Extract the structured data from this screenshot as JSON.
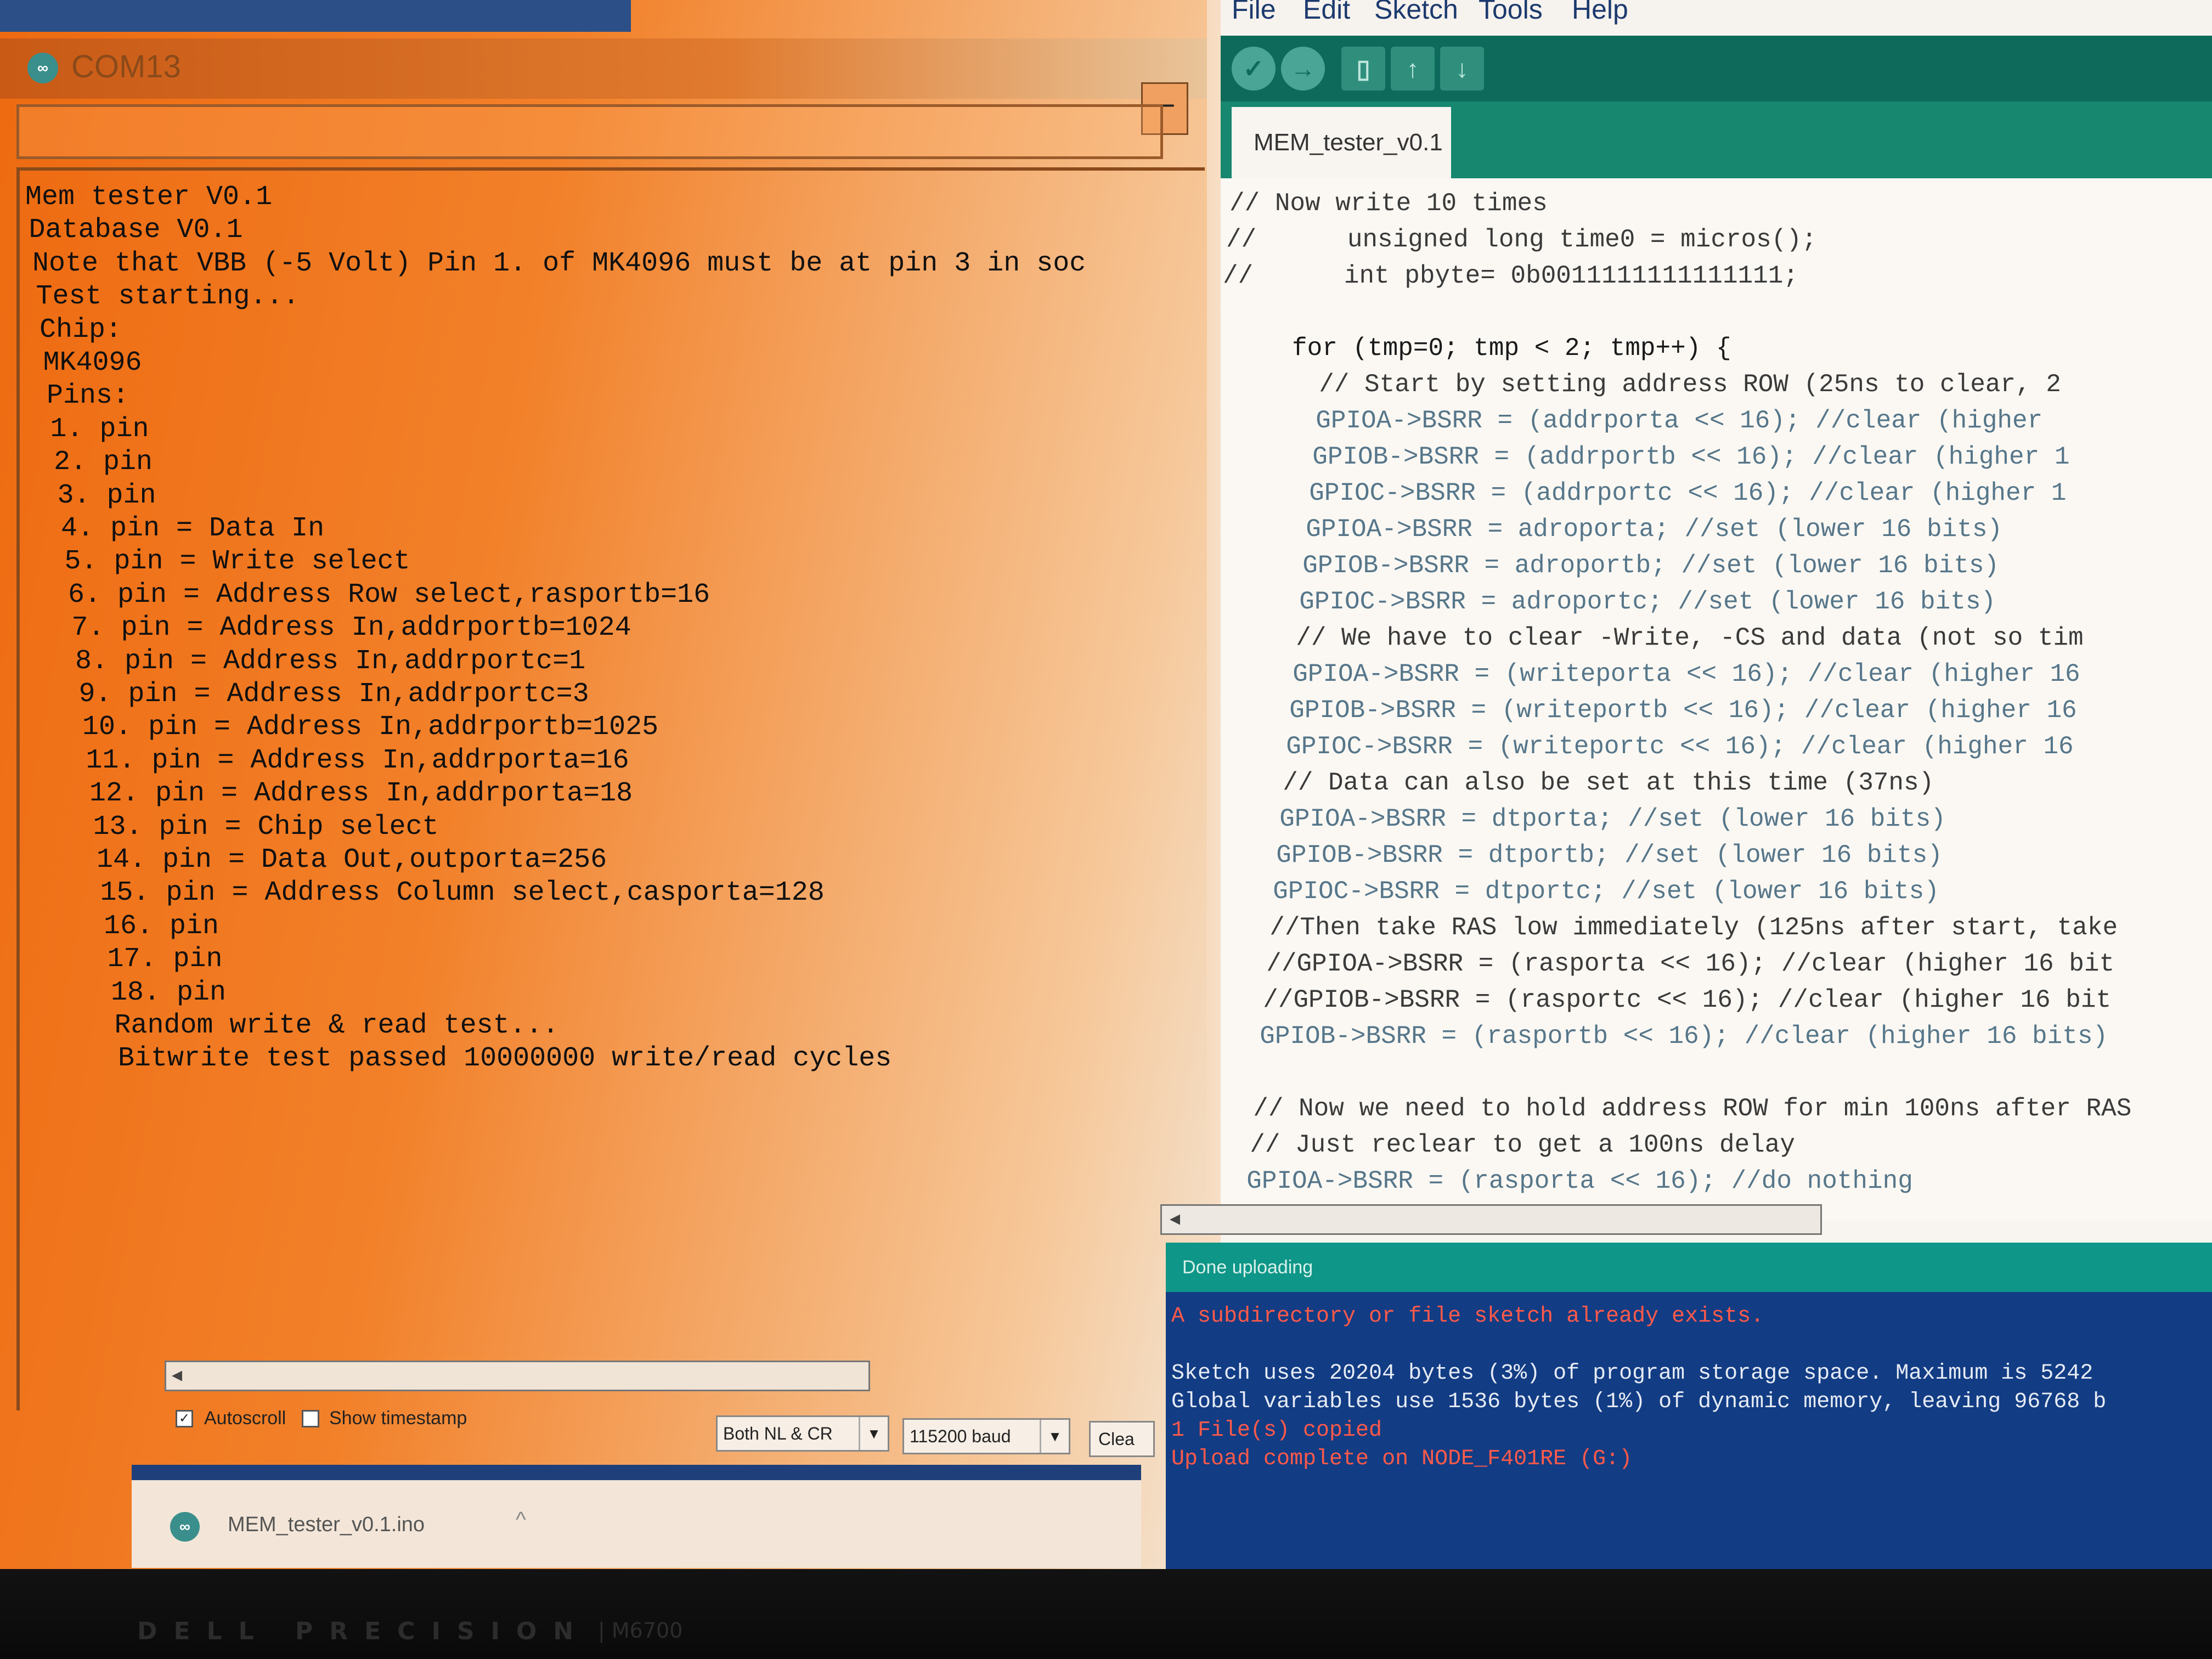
{
  "serial_monitor": {
    "title": "COM13",
    "output_lines": [
      "Mem tester V0.1",
      "Database V0.1",
      "Note that VBB (-5 Volt) Pin 1. of MK4096 must be at pin 3 in soc",
      "Test starting...",
      "Chip:",
      "MK4096",
      "Pins:",
      "1. pin",
      "2. pin",
      "3. pin",
      "4. pin = Data In",
      "5. pin = Write select",
      "6. pin = Address Row select,rasportb=16",
      "7. pin = Address In,addrportb=1024",
      "8. pin = Address In,addrportc=1",
      "9. pin = Address In,addrportc=3",
      "10. pin = Address In,addrportb=1025",
      "11. pin = Address In,addrporta=16",
      "12. pin = Address In,addrporta=18",
      "13. pin = Chip select",
      "14. pin = Data Out,outporta=256",
      "15. pin = Address Column select,casporta=128",
      "16. pin",
      "17. pin",
      "18. pin",
      "Random write & read test...",
      "Bitwrite test passed 10000000 write/read cycles"
    ],
    "autoscroll_label": "Autoscroll",
    "autoscroll_checked": true,
    "timestamp_label": "Show timestamp",
    "timestamp_checked": false,
    "line_ending": "Both NL & CR",
    "baud": "115200 baud",
    "clear_label": "Clea",
    "minimize_label": "–"
  },
  "taskbar": {
    "file": "MEM_tester_v0.1.ino",
    "caret": "^"
  },
  "ide": {
    "menu": [
      "File",
      "Edit",
      "Sketch",
      "Tools",
      "Help"
    ],
    "toolbar_icons": [
      "verify-icon",
      "upload-icon",
      "new-icon",
      "open-icon",
      "save-icon"
    ],
    "tab": "MEM_tester_v0.1",
    "code_lines": [
      "// Now write 10 times",
      "//      unsigned long time0 = micros();",
      "//      int pbyte= 0b0011111111111111;",
      "",
      "     for (tmp=0; tmp < 2; tmp++) {",
      "       // Start by setting address ROW (25ns to clear, 2",
      "       GPIOA->BSRR = (addrporta << 16); //clear (higher",
      "       GPIOB->BSRR = (addrportb << 16); //clear (higher 1",
      "       GPIOC->BSRR = (addrportc << 16); //clear (higher 1",
      "       GPIOA->BSRR = adroporta; //set (lower 16 bits)",
      "       GPIOB->BSRR = adroportb; //set (lower 16 bits)",
      "       GPIOC->BSRR = adroportc; //set (lower 16 bits)",
      "       // We have to clear -Write, -CS and data (not so tim",
      "       GPIOA->BSRR = (writeporta << 16); //clear (higher 16",
      "       GPIOB->BSRR = (writeportb << 16); //clear (higher 16",
      "       GPIOC->BSRR = (writeportc << 16); //clear (higher 16",
      "       // Data can also be set at this time (37ns)",
      "       GPIOA->BSRR = dtporta; //set (lower 16 bits)",
      "       GPIOB->BSRR = dtportb; //set (lower 16 bits)",
      "       GPIOC->BSRR = dtportc; //set (lower 16 bits)",
      "       //Then take RAS low immediately (125ns after start, take",
      "       //GPIOA->BSRR = (rasporta << 16); //clear (higher 16 bit",
      "       //GPIOB->BSRR = (rasportc << 16); //clear (higher 16 bit",
      "       GPIOB->BSRR = (rasportb << 16); //clear (higher 16 bits)",
      "",
      "       // Now we need to hold address ROW for min 100ns after RAS",
      "       // Just reclear to get a 100ns delay",
      "       GPIOA->BSRR = (rasporta << 16); //do nothing"
    ],
    "status": "Done uploading",
    "console_lines": [
      {
        "text": "A subdirectory or file sketch already exists.",
        "kind": "err"
      },
      {
        "text": "",
        "kind": "info"
      },
      {
        "text": "Sketch uses 20204 bytes (3%) of program storage space. Maximum is 5242",
        "kind": "info"
      },
      {
        "text": "Global variables use 1536 bytes (1%) of dynamic memory, leaving 96768 b",
        "kind": "info"
      },
      {
        "text": "1 File(s) copied",
        "kind": "err"
      },
      {
        "text": "Upload complete on NODE_F401RE (G:)",
        "kind": "err"
      }
    ]
  },
  "bezel": {
    "brand": "DELL PRECISION",
    "model": "| M6700"
  },
  "colors": {
    "serial_bg": "#f2812a",
    "ide_toolbar": "#0e6a5a",
    "ide_tabbar": "#17876f",
    "status_bar": "#0e9688",
    "console_bg": "#123c84",
    "console_error": "#ff5a4a"
  }
}
